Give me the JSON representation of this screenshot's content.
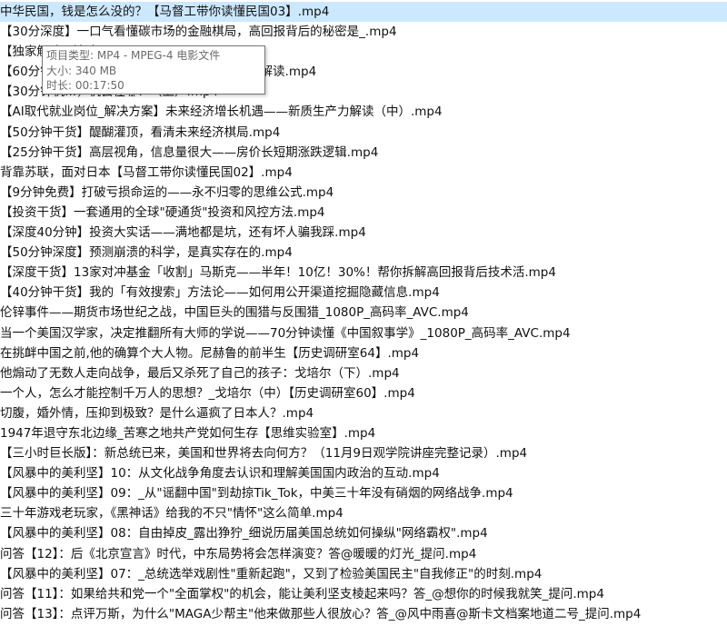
{
  "files": [
    {
      "name": "中华民国，钱是怎么没的？【马督工带你读懂民国03】.mp4",
      "selected": true
    },
    {
      "name": "【30分深度】一口气看懂碳市场的金融棋局，高回报背后的秘密是_.mp4",
      "selected": false
    },
    {
      "name": "【独家解读...法论.mp4",
      "selected": false
    },
    {
      "name": "【60分钟深...何与我有关？新质生产力，具像化解读.mp4",
      "selected": false
    },
    {
      "name": "【30分钟机...，机会在哪？（上）.mp4",
      "selected": false
    },
    {
      "name": "【AI取代就业岗位_解决方案】未来经济增长机遇——新质生产力解读（中）.mp4",
      "selected": false
    },
    {
      "name": "【50分钟干货】醍醐灌顶，看清未来经济棋局.mp4",
      "selected": false
    },
    {
      "name": "【25分钟干货】高层视角，信息量很大——房价长短期涨跌逻辑.mp4",
      "selected": false
    },
    {
      "name": "背靠苏联，面对日本【马督工带你读懂民国02】.mp4",
      "selected": false
    },
    {
      "name": "【9分钟免费】打破亏损命运的——永不归零的思维公式.mp4",
      "selected": false
    },
    {
      "name": "【投资干货】一套通用的全球\"硬通货\"投资和风控方法.mp4",
      "selected": false
    },
    {
      "name": "【深度40分钟】投资大实话——满地都是坑，还有坏人骗我踩.mp4",
      "selected": false
    },
    {
      "name": "【50分钟深度】预测崩溃的科学，是真实存在的.mp4",
      "selected": false
    },
    {
      "name": "【深度干货】13家对冲基金「收割」马斯克——半年！10亿！30%！帮你拆解高回报背后技术活.mp4",
      "selected": false
    },
    {
      "name": "【40分钟干货】我的「有效搜索」方法论——如何用公开渠道挖掘隐藏信息.mp4",
      "selected": false
    },
    {
      "name": "伦锌事件——期货市场世纪之战，中国巨头的围猎与反围猎_1080P_高码率_AVC.mp4",
      "selected": false
    },
    {
      "name": "当一个美国汉学家，决定推翻所有大师的学说——70分钟读懂《中国叙事学》_1080P_高码率_AVC.mp4",
      "selected": false
    },
    {
      "name": "在挑衅中国之前,他的确算个大人物。尼赫鲁的前半生【历史调研室64】.mp4",
      "selected": false
    },
    {
      "name": "他煽动了无数人走向战争，最后又杀死了自己的孩子：戈培尔（下）.mp4",
      "selected": false
    },
    {
      "name": "一个人，怎么才能控制千万人的思想？_戈培尔（中）【历史调研室60】.mp4",
      "selected": false
    },
    {
      "name": "切腹，婚外情，压抑到极致？是什么逼疯了日本人？.mp4",
      "selected": false
    },
    {
      "name": "1947年退守东北边缘_苦寒之地共产党如何生存【思维实验室】.mp4",
      "selected": false
    },
    {
      "name": "【三小时巨长版】：新总统已来，美国和世界将去向何方？（11月9日观学院讲座完整记录）.mp4",
      "selected": false
    },
    {
      "name": "【风暴中的美利坚】10：从文化战争角度去认识和理解美国国内政治的互动.mp4",
      "selected": false
    },
    {
      "name": "【风暴中的美利坚】09：_从\"谣翻中国\"到劫掠Tik_Tok，中美三十年没有硝烟的网络战争.mp4",
      "selected": false
    },
    {
      "name": "三十年游戏老玩家，《黑神话》给我的不只\"情怀\"这么简单.mp4",
      "selected": false
    },
    {
      "name": "【风暴中的美利坚】08：自由掉皮_露出狰狞_细说历届美国总统如何操纵\"网络霸权\".mp4",
      "selected": false
    },
    {
      "name": "问答【12】：后《北京宣言》时代，中东局势将会怎样演变？答@暖暖的灯光_提问.mp4",
      "selected": false
    },
    {
      "name": "【风暴中的美利坚】07：_总统选举戏剧性\"重新起跑\"，又到了检验美国民主\"自我修正\"的时刻.mp4",
      "selected": false
    },
    {
      "name": "问答【11】：如果给共和党一个\"全面掌权\"的机会，能让美利坚支棱起来吗？答_@想你的时候我就笑_提问.mp4",
      "selected": false
    },
    {
      "name": "问答【13】：点评万斯，为什么\"MAGA少帮主\"他来做那些人很放心？答_@风中雨喜@斯卡文档案地道二号_提问.mp4",
      "selected": false
    }
  ],
  "tooltip": {
    "type_line": "项目类型: MP4 - MPEG-4 电影文件",
    "size_line": "大小: 340 MB",
    "duration_line": "时长: 00:17:50"
  },
  "colors": {
    "selection": "#cce8ff",
    "text": "#111111",
    "tooltip_text": "#6b6b6b",
    "tooltip_border": "#767676"
  }
}
